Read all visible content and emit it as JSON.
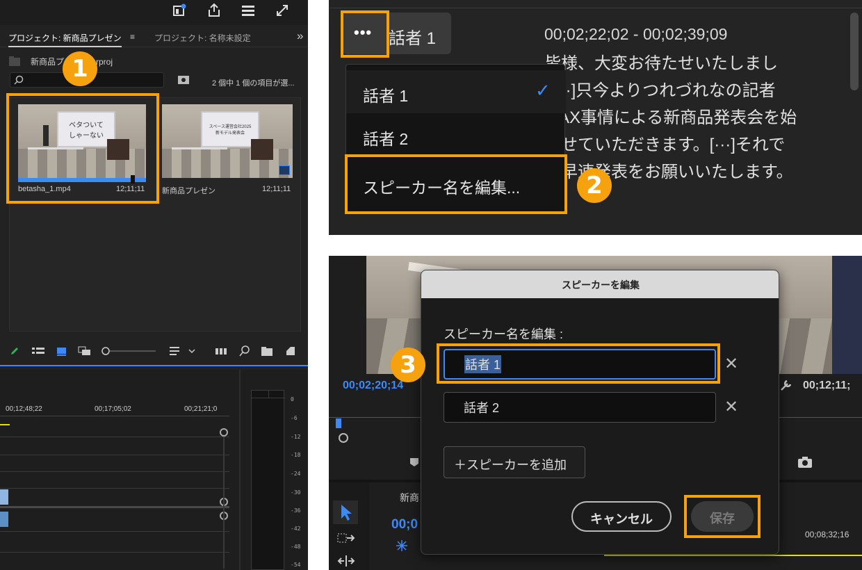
{
  "left_panel": {
    "tabs": [
      "プロジェクト: 新商品プレゼン",
      "プロジェクト: 名称未設定"
    ],
    "tab_menu_glyph": "≡",
    "more_glyph": "»",
    "project_file": "新商品プレゼン.prproj",
    "item_count": "2 個中 1 個の項目が選...",
    "clips": [
      {
        "name": "betasha_1.mp4",
        "duration": "12;11;11",
        "screen_text": "ベタついて\nしゃーない"
      },
      {
        "name": "新商品プレゼン",
        "duration": "12;11;11",
        "screen_text": "スペース運営会社2025\n新モデル発表会"
      }
    ],
    "timecodes": [
      "00;12;48;22",
      "00;17;05;02",
      "00;21;21;0"
    ],
    "meter_ticks": [
      "0",
      "-6",
      "-12",
      "-18",
      "-24",
      "-30",
      "-36",
      "-42",
      "-48",
      "-54"
    ]
  },
  "transcript": {
    "speaker_chip": "話者 1",
    "more_glyph": "•••",
    "timecode": "00;02;22;02 - 00;02;39;09",
    "lines": [
      "皆様、大変お待たせいたしまし",
      "。[···]只今よりつれづれなの記者",
      "MAX事情による新商品発表会を始",
      "させていただきます。[···]それで",
      "、早速発表をお願いいたします。"
    ],
    "menu": {
      "items": [
        "話者 1",
        "話者 2",
        "スピーカー名を編集..."
      ],
      "checked_glyph": "✓"
    }
  },
  "dialog_scene": {
    "timecode_left": "00;02;20;14",
    "timecode_right": "00;12;11;",
    "seq_name": "新商",
    "seq_timecode": "00;0",
    "track_timecode": "00;08;32;16",
    "dialog": {
      "title": "スピーカーを編集",
      "label": "スピーカー名を編集 :",
      "fields": [
        "話者 1",
        "話者 2"
      ],
      "remove_glyph": "✕",
      "add_button": "＋スピーカーを追加",
      "cancel": "キャンセル",
      "save": "保存"
    }
  },
  "badges": [
    "1",
    "2",
    "3"
  ],
  "colors": {
    "highlight": "#f6a20f",
    "panel": "#1f1f1f",
    "accent_blue": "#3d8af7",
    "dialog_bg": "#1b1b1b"
  }
}
